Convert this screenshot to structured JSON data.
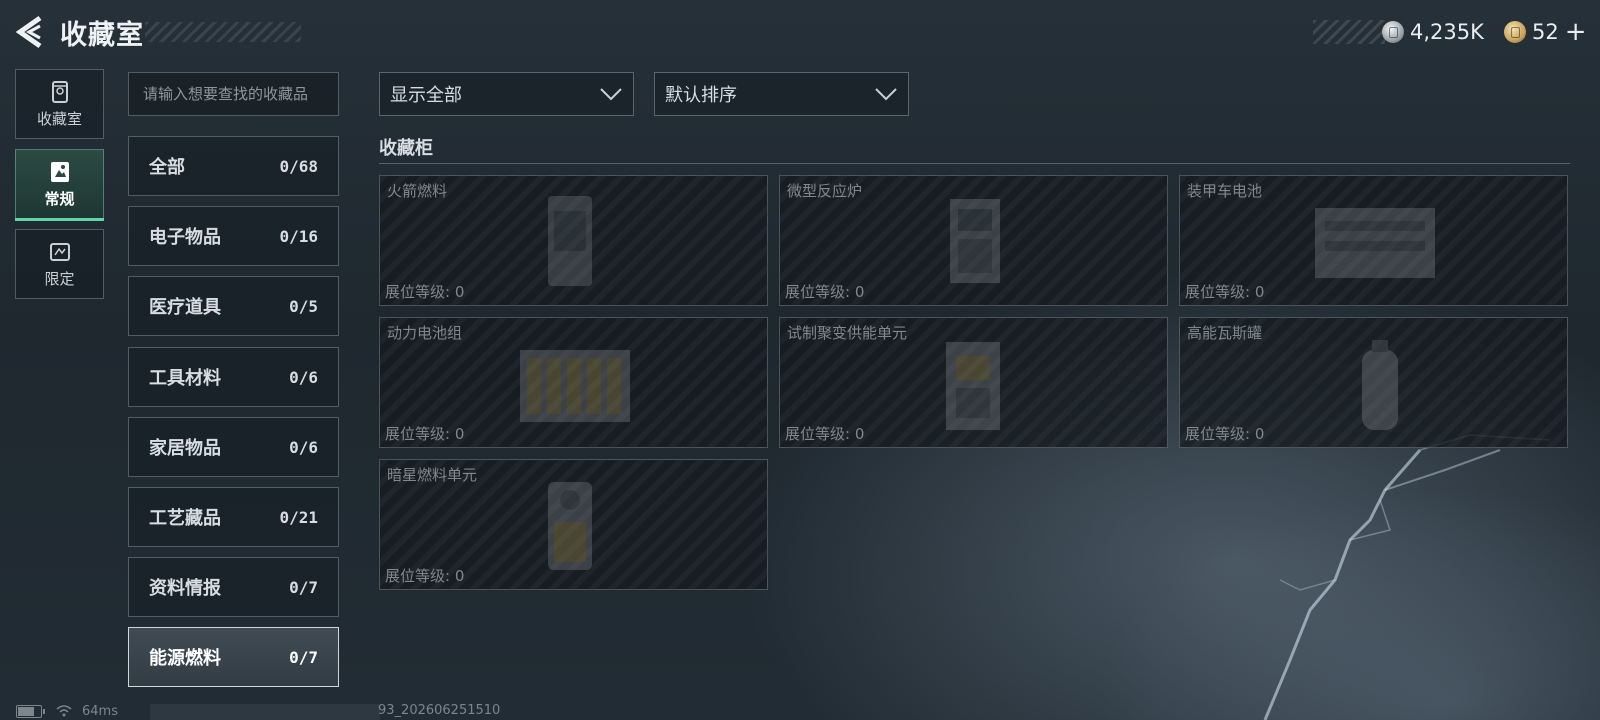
{
  "header": {
    "title": "收藏室",
    "currencies": [
      {
        "icon": "silver-coin-icon",
        "value": "4,235K"
      },
      {
        "icon": "gold-coin-icon",
        "value": "52"
      }
    ],
    "plus_label": "+"
  },
  "side_tabs": [
    {
      "label": "收藏室",
      "icon": "collection-room-icon",
      "active": false
    },
    {
      "label": "常规",
      "icon": "regular-icon",
      "active": true
    },
    {
      "label": "限定",
      "icon": "limited-icon",
      "active": false
    }
  ],
  "search": {
    "placeholder": "请输入想要查找的收藏品",
    "value": ""
  },
  "categories": [
    {
      "label": "全部",
      "count": "0/68"
    },
    {
      "label": "电子物品",
      "count": "0/16"
    },
    {
      "label": "医疗道具",
      "count": "0/5"
    },
    {
      "label": "工具材料",
      "count": "0/6"
    },
    {
      "label": "家居物品",
      "count": "0/6"
    },
    {
      "label": "工艺藏品",
      "count": "0/21"
    },
    {
      "label": "资料情报",
      "count": "0/7"
    },
    {
      "label": "能源燃料",
      "count": "0/7",
      "selected": true
    }
  ],
  "filters": {
    "show": {
      "label": "显示全部"
    },
    "sort": {
      "label": "默认排序"
    }
  },
  "section": {
    "title": "收藏柜"
  },
  "items": [
    {
      "name": "火箭燃料",
      "level": "展位等级: 0"
    },
    {
      "name": "微型反应炉",
      "level": "展位等级: 0"
    },
    {
      "name": "装甲车电池",
      "level": "展位等级: 0"
    },
    {
      "name": "动力电池组",
      "level": "展位等级: 0"
    },
    {
      "name": "试制聚变供能单元",
      "level": "展位等级: 0"
    },
    {
      "name": "高能瓦斯罐",
      "level": "展位等级: 0"
    },
    {
      "name": "暗星燃料单元",
      "level": "展位等级: 0"
    }
  ],
  "status": {
    "ping": "64ms",
    "build": "93_202606251510"
  },
  "colors": {
    "accent": "#5fd6a8",
    "background": "#222c34",
    "muted_text": "#7f888f"
  }
}
